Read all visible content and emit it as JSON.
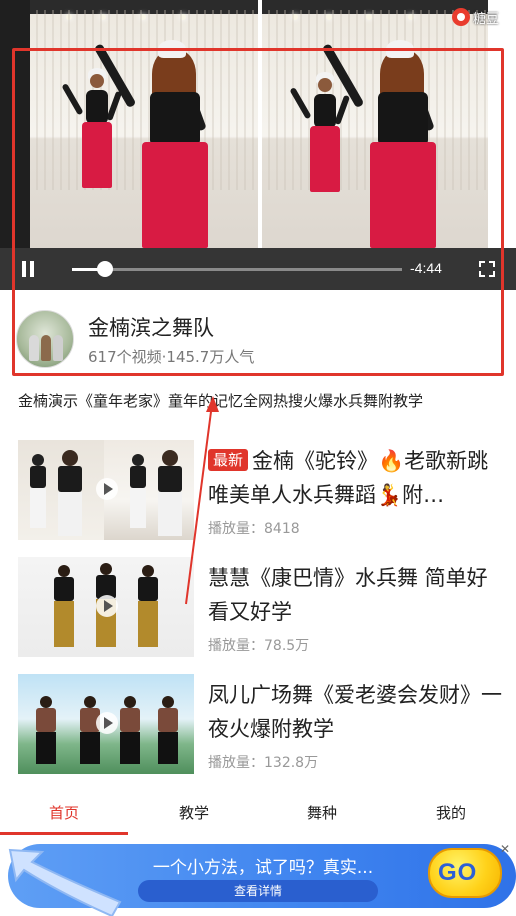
{
  "watermark": {
    "text": "糖豆"
  },
  "player": {
    "time_remaining": "-4:44",
    "progress": 0.1
  },
  "author": {
    "name": "金楠滨之舞队",
    "meta": "617个视频·145.7万人气"
  },
  "video": {
    "description": "金楠演示《童年老家》童年的记忆全网热搜火爆水兵舞附教学"
  },
  "related": [
    {
      "badge": "最新",
      "title": "金楠《驼铃》🔥老歌新跳唯美单人水兵舞蹈💃附…",
      "views": "播放量：8418"
    },
    {
      "badge": "",
      "title": "慧慧《康巴情》水兵舞 简单好看又好学",
      "views": "播放量：78.5万"
    },
    {
      "badge": "",
      "title": "凤儿广场舞《爱老婆会发财》一夜火爆附教学",
      "views": "播放量：132.8万"
    }
  ],
  "nav": {
    "items": [
      "首页",
      "教学",
      "舞种",
      "我的"
    ],
    "active_index": 0
  },
  "ad": {
    "headline": "一个小方法，试了吗？真实...",
    "button": "查看详情",
    "go": "GO",
    "close": "✕"
  },
  "colors": {
    "accent": "#e0352b",
    "pants": "#d81b43",
    "ad_blue": "#3f84ef"
  }
}
